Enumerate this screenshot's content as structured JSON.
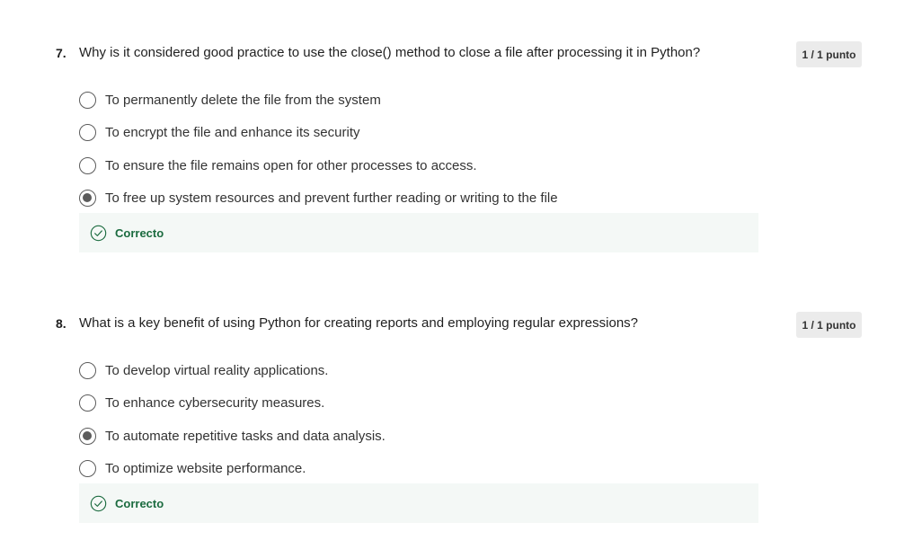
{
  "colors": {
    "correct": "#1b6b3f",
    "feedback_bg": "#f4f8f6",
    "score_bg": "#ebebeb"
  },
  "questions": [
    {
      "number": "7.",
      "text": "Why is it considered good practice to use the close() method to close a file after processing it in Python?",
      "score": "1 / 1 punto",
      "options": [
        {
          "label": "To permanently delete the file from the system",
          "selected": false
        },
        {
          "label": "To encrypt the file and enhance its security",
          "selected": false
        },
        {
          "label": "To ensure the file remains open for other processes to access.",
          "selected": false
        },
        {
          "label": "To free up system resources and prevent further reading or writing to the file",
          "selected": true
        }
      ],
      "feedback": {
        "icon": "check-circle-icon",
        "label": "Correcto"
      }
    },
    {
      "number": "8.",
      "text": "What is a key benefit of using Python for creating reports and employing regular expressions?",
      "score": "1 / 1 punto",
      "options": [
        {
          "label": "To develop virtual reality applications.",
          "selected": false
        },
        {
          "label": "To enhance cybersecurity measures.",
          "selected": false
        },
        {
          "label": "To automate repetitive tasks and data analysis.",
          "selected": true
        },
        {
          "label": "To optimize website performance.",
          "selected": false
        }
      ],
      "feedback": {
        "icon": "check-circle-icon",
        "label": "Correcto"
      }
    }
  ]
}
